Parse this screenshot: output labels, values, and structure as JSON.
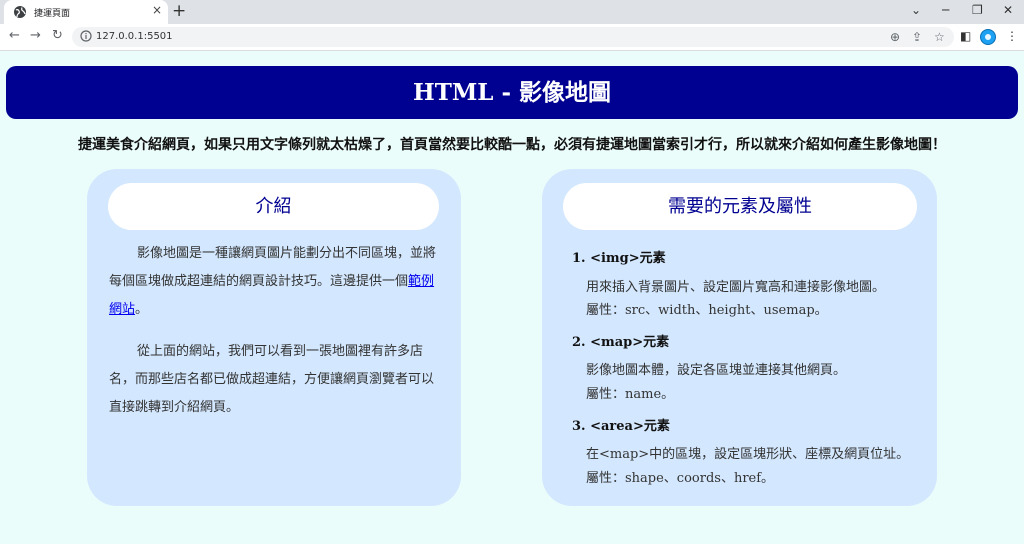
{
  "browser": {
    "tab_title": "捷運頁面",
    "tab_close": "×",
    "new_tab": "+",
    "url": "127.0.0.1:5501",
    "icons": [
      "globe-icon",
      "back-icon",
      "forward-icon",
      "reload-icon",
      "info-icon",
      "zoom-icon",
      "share-icon",
      "star-icon",
      "sidepanel-icon",
      "menu-icon"
    ]
  },
  "page": {
    "header_title": "HTML - 影像地圖",
    "intro": "捷運美食介紹網頁，如果只用文字條列就太枯燥了，首頁當然要比較酷一點，必須有捷運地圖當索引才行，所以就來介紹如何產生影像地圖！",
    "left_card": {
      "title": "介紹",
      "para1_before_link": "影像地圖是一種讓網頁圖片能劃分出不同區塊，並將每個區塊做成超連結的網頁設計技巧。這邊提供一個",
      "para1_link": "範例網站",
      "para1_after_link": "。",
      "para2": "從上面的網站，我們可以看到一張地圖裡有許多店名，而那些店名都已做成超連結，方便讓網頁瀏覽者可以直接跳轉到介紹網頁。"
    },
    "right_card": {
      "title": "需要的元素及屬性",
      "items": [
        {
          "title": "1. <img>元素",
          "line1": "用來插入背景圖片、設定圖片寬高和連接影像地圖。",
          "line2": "屬性：src、width、height、usemap。"
        },
        {
          "title": "2. <map>元素",
          "line1": "影像地圖本體，設定各區塊並連接其他網頁。",
          "line2": "屬性：name。"
        },
        {
          "title": "3. <area>元素",
          "line1": "在<map>中的區塊，設定區塊形狀、座標及網頁位址。",
          "line2": "屬性：shape、coords、href。"
        }
      ]
    },
    "colors": {
      "header_bg": "#000091",
      "page_bg": "#ebfdfb",
      "card_bg": "#d3e7fe",
      "title_text": "#000091"
    }
  }
}
